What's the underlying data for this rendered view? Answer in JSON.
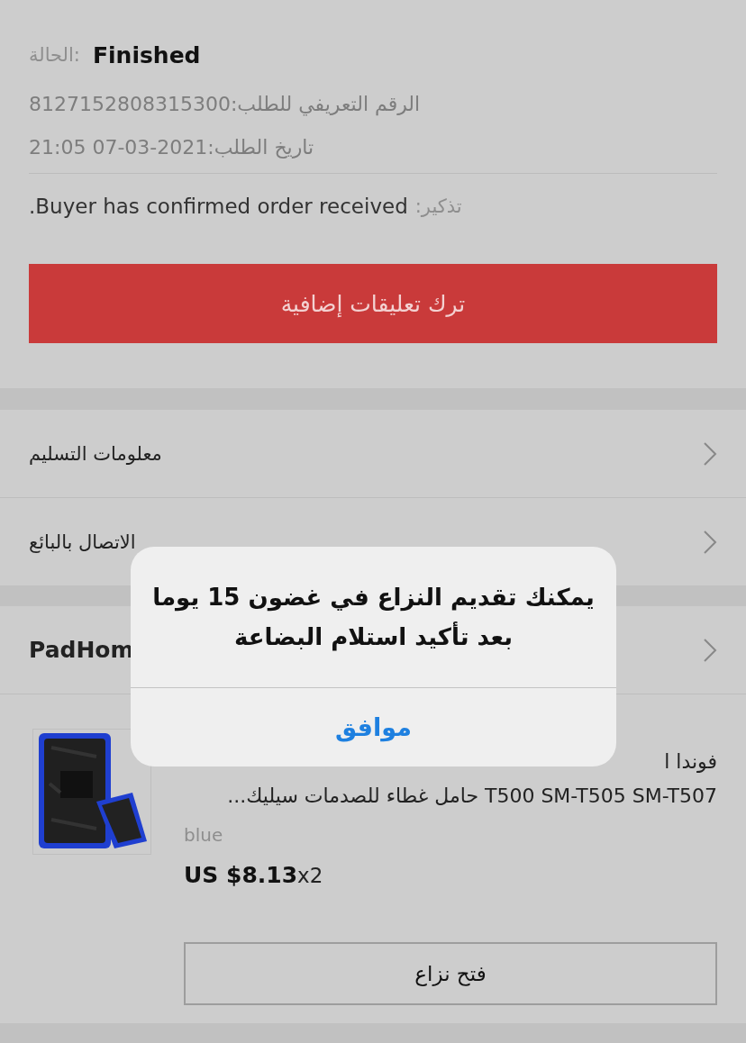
{
  "order": {
    "status_label": "الحالة:",
    "status": "Finished",
    "id_label": "الرقم التعريفي للطلب:",
    "id": "8127152808315300",
    "date_label": "تاريخ الطلب:",
    "date": "21:05 07-03-2021",
    "reminder_label": "تذكير:",
    "reminder": "Buyer has confirmed order received.",
    "feedback_button": "ترك تعليقات إضافية"
  },
  "links": [
    {
      "label": "معلومات التسليم"
    },
    {
      "label": "الاتصال بالبائع"
    }
  ],
  "store": {
    "name": "PadHom"
  },
  "product": {
    "title_line_1": "فوندا ا",
    "title_line_2": "T500 SM-T505 SM-T507 حامل غطاء للصدمات سيليك...",
    "variant": "blue",
    "price": "US $8.13",
    "quantity": "x2",
    "dispute_button": "فتح نزاع"
  },
  "dialog": {
    "message": "يمكنك تقديم النزاع في غضون 15 يوما بعد تأكيد استلام البضاعة",
    "ok_button": "موافق"
  }
}
